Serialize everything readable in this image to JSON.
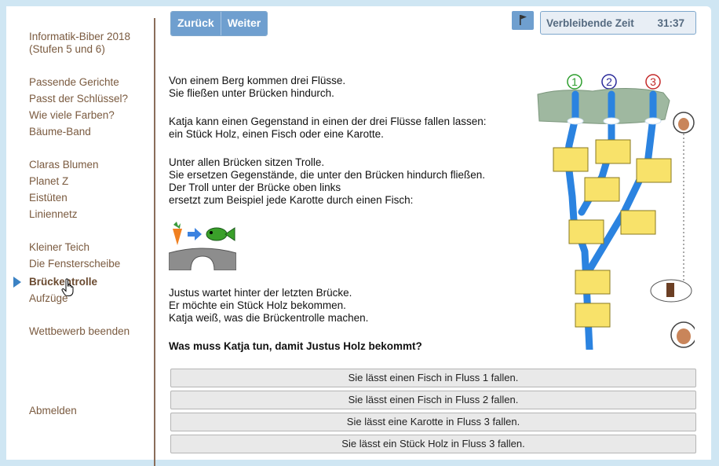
{
  "sidebar": {
    "title_line1": "Informatik-Biber 2018",
    "title_line2": "(Stufen 5 und 6)",
    "items": [
      {
        "label": "Passende Gerichte"
      },
      {
        "label": "Passt der Schlüssel?"
      },
      {
        "label": "Wie viele Farben?"
      },
      {
        "label": "Bäume-Band"
      },
      {
        "label": "Claras Blumen"
      },
      {
        "label": "Planet Z"
      },
      {
        "label": "Eistüten"
      },
      {
        "label": "Liniennetz"
      },
      {
        "label": "Kleiner Teich"
      },
      {
        "label": "Die Fensterscheibe"
      },
      {
        "label": "Brückentrolle"
      },
      {
        "label": "Aufzüge"
      },
      {
        "label": "Wettbewerb beenden"
      },
      {
        "label": "Abmelden"
      }
    ],
    "active_item": "Brückentrolle"
  },
  "toolbar": {
    "back_label": "Zurück",
    "next_label": "Weiter",
    "timer_label": "Verbleibende Zeit",
    "timer_value": "31:37"
  },
  "task": {
    "p1": "Von einem Berg kommen drei Flüsse.\nSie fließen unter Brücken hindurch.",
    "p2": "Katja kann einen Gegenstand in einen der drei Flüsse fallen lassen:\nein Stück Holz, einen Fisch oder eine Karotte.",
    "p3": "Unter allen Brücken sitzen Trolle.\nSie ersetzen Gegenstände, die unter den Brücken hindurch fließen.\nDer Troll unter der Brücke oben links\nersetzt zum Beispiel jede Karotte durch einen Fisch:",
    "p4": "Justus wartet hinter der letzten Brücke.\nEr möchte ein Stück Holz bekommen.\nKatja weiß, was die Brückentrolle machen.",
    "question": "Was muss Katja tun, damit Justus Holz bekommt?",
    "river_labels": [
      "1",
      "2",
      "3"
    ],
    "river_colors": [
      "#2e9e2e",
      "#2a2a9a",
      "#c42a2a"
    ]
  },
  "answers": [
    {
      "label": "Sie lässt einen Fisch in Fluss 1 fallen."
    },
    {
      "label": "Sie lässt einen Fisch in Fluss 2 fallen."
    },
    {
      "label": "Sie lässt eine Karotte in Fluss 3 fallen."
    },
    {
      "label": "Sie lässt ein Stück Holz in Fluss 3 fallen."
    }
  ]
}
